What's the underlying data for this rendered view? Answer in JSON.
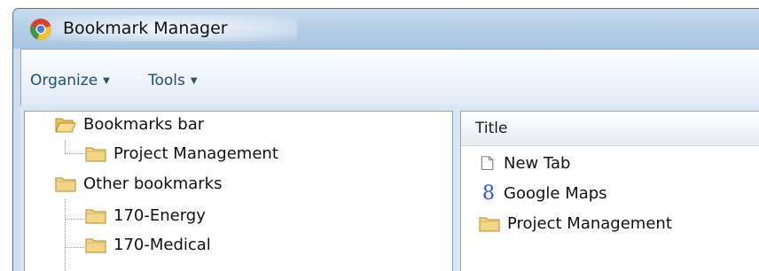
{
  "window": {
    "title": "Bookmark Manager"
  },
  "toolbar": {
    "menus": [
      {
        "label": "Organize",
        "icon": "chevron-down-icon"
      },
      {
        "label": "Tools",
        "icon": "chevron-down-icon"
      }
    ]
  },
  "tree": {
    "items": [
      {
        "label": "Bookmarks bar",
        "icon": "folder-open-icon",
        "level": 0
      },
      {
        "label": "Project Management",
        "icon": "folder-icon",
        "level": 1
      },
      {
        "label": "Other bookmarks",
        "icon": "folder-icon",
        "level": 0
      },
      {
        "label": "170-Energy",
        "icon": "folder-icon",
        "level": 1
      },
      {
        "label": "170-Medical",
        "icon": "folder-icon",
        "level": 1
      }
    ]
  },
  "list": {
    "column_header": "Title",
    "items": [
      {
        "label": "New Tab",
        "icon": "page-icon"
      },
      {
        "label": "Google Maps",
        "icon": "google-favicon"
      },
      {
        "label": "Project Management",
        "icon": "folder-icon"
      }
    ]
  },
  "colors": {
    "titlebar": "#b5cfe7",
    "menu_text": "#1f4e7a",
    "folder": "#f1d27a"
  }
}
